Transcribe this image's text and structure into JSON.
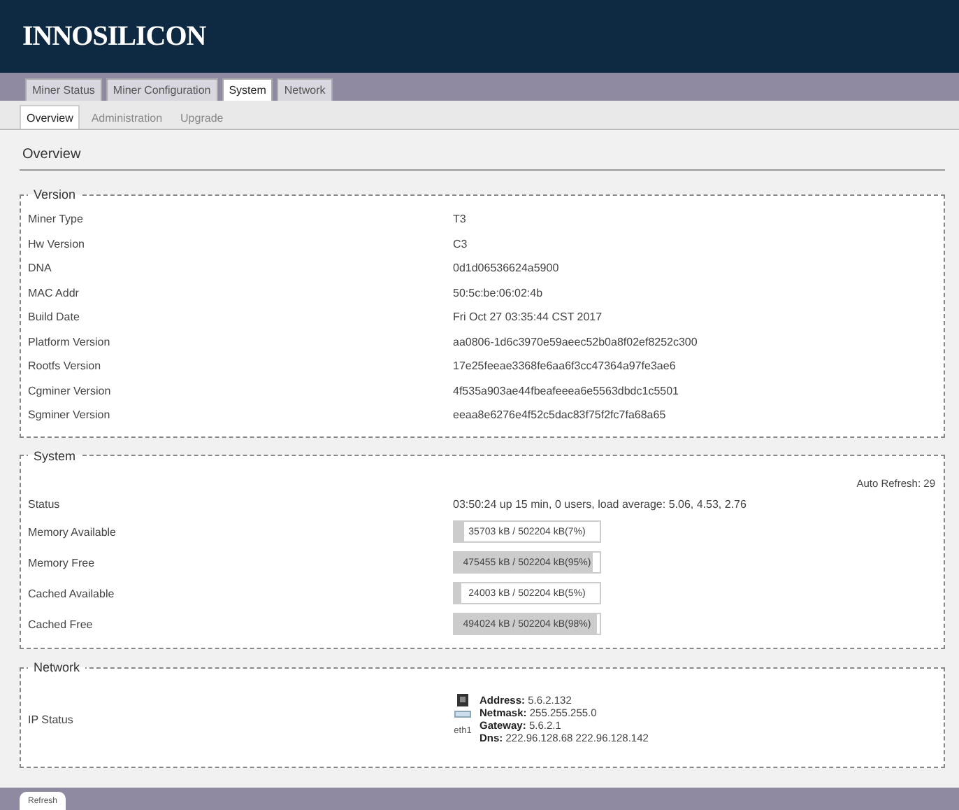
{
  "header": {
    "logo": "INNOSILICON"
  },
  "tabs": [
    {
      "label": "Miner Status",
      "selected": false
    },
    {
      "label": "Miner Configuration",
      "selected": false
    },
    {
      "label": "System",
      "selected": true
    },
    {
      "label": "Network",
      "selected": false
    }
  ],
  "subtabs": [
    {
      "label": "Overview",
      "selected": true
    },
    {
      "label": "Administration",
      "selected": false
    },
    {
      "label": "Upgrade",
      "selected": false
    }
  ],
  "page_title": "Overview",
  "sections": [
    {
      "legend": "Version",
      "rows": [
        {
          "kind": "text",
          "label": "Miner Type",
          "value": "T3"
        },
        {
          "kind": "text",
          "label": "Hw Version",
          "value": "C3"
        },
        {
          "kind": "text",
          "label": "DNA",
          "value": "0d1d06536624a5900"
        },
        {
          "kind": "text",
          "label": "MAC Addr",
          "value": "50:5c:be:06:02:4b"
        },
        {
          "kind": "text",
          "label": "Build Date",
          "value": "Fri Oct 27 03:35:44 CST 2017"
        },
        {
          "kind": "text",
          "label": "Platform Version",
          "value": "aa0806-1d6c3970e59aeec52b0a8f02ef8252c300"
        },
        {
          "kind": "text",
          "label": "Rootfs Version",
          "value": "17e25feeae3368fe6aa6f3cc47364a97fe3ae6"
        },
        {
          "kind": "text",
          "label": "Cgminer Version",
          "value": "4f535a903ae44fbeafeeea6e5563dbdc1c5501"
        },
        {
          "kind": "text",
          "label": "Sgminer Version",
          "value": "eeaa8e6276e4f52c5dac83f75f2fc7fa68a65"
        }
      ]
    },
    {
      "legend": "System",
      "auto_refresh": "Auto Refresh: 29",
      "rows": [
        {
          "kind": "text",
          "label": "Status",
          "value": "03:50:24 up 15 min, 0 users, load average: 5.06, 4.53, 2.76"
        },
        {
          "kind": "bar",
          "label": "Memory Available",
          "value": "35703 kB / 502204 kB(7%)",
          "level": 0.07
        },
        {
          "kind": "bar",
          "label": "Memory Free",
          "value": "475455 kB / 502204 kB(95%)",
          "level": 0.95
        },
        {
          "kind": "bar",
          "label": "Cached Available",
          "value": "24003 kB / 502204 kB(5%)",
          "level": 0.05
        },
        {
          "kind": "bar",
          "label": "Cached Free",
          "value": "494024 kB / 502204 kB(98%)",
          "level": 0.98
        }
      ]
    },
    {
      "legend": "Network",
      "rows": [
        {
          "kind": "ip",
          "label": "IP Status",
          "caption": "eth1",
          "lines": [
            {
              "label": "Address:",
              "value": "5.6.2.132"
            },
            {
              "label": "Netmask:",
              "value": "255.255.255.0"
            },
            {
              "label": "Gateway:",
              "value": "5.6.2.1"
            },
            {
              "label": "Dns:",
              "value": "222.96.128.68 222.96.128.142"
            }
          ]
        }
      ]
    }
  ],
  "footer_tab": {
    "label": "Refresh"
  }
}
